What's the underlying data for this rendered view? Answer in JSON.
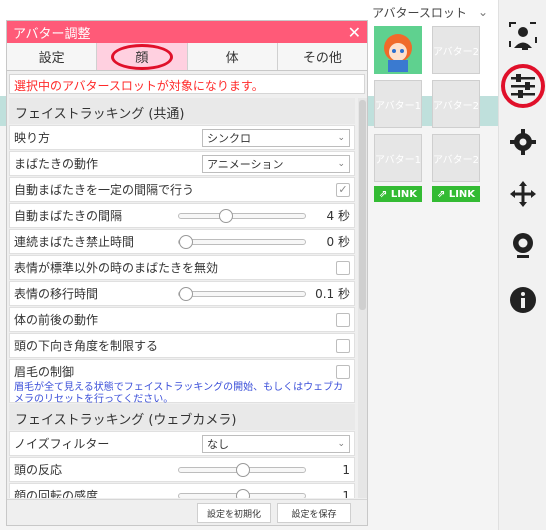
{
  "window": {
    "title": "アバター調整",
    "close_symbol": "✕"
  },
  "tabs": [
    {
      "label": "設定"
    },
    {
      "label": "顔",
      "active": true
    },
    {
      "label": "体"
    },
    {
      "label": "その他"
    }
  ],
  "notice": "選択中のアバタースロットが対象になります。",
  "sections": {
    "face_tracking_common": "フェイストラッキング (共通)",
    "face_tracking_webcam": "フェイストラッキング (ウェブカメラ)"
  },
  "rows": {
    "reflection": {
      "label": "映り方",
      "value": "シンクロ"
    },
    "blink_action": {
      "label": "まばたきの動作",
      "value": "アニメーション"
    },
    "blink_regular": {
      "label": "自動まばたきを一定の間隔で行う",
      "checked": true
    },
    "blink_interval": {
      "label": "自動まばたきの間隔",
      "value": "4 秒",
      "level": 0.35
    },
    "blink_cooldown": {
      "label": "連続まばたき禁止時間",
      "value": "0 秒",
      "level": 0.0
    },
    "disable_blink": {
      "label": "表情が標準以外の時のまばたきを無効",
      "checked": false
    },
    "expression_transition": {
      "label": "表情の移行時間",
      "value": "0.1 秒",
      "level": 0.0
    },
    "body_forward": {
      "label": "体の前後の動作",
      "checked": false
    },
    "head_down_limit": {
      "label": "頭の下向き角度を制限する",
      "checked": false
    },
    "eyebrow_control": {
      "label": "眉毛の制御",
      "checked": false,
      "note": "眉毛が全て見える状態でフェイストラッキングの開始、もしくはウェブカメラのリセットを行ってください。"
    },
    "noise_filter": {
      "label": "ノイズフィルター",
      "value": "なし"
    },
    "head_response": {
      "label": "頭の反応",
      "value": "1",
      "level": 0.5
    },
    "face_rotation": {
      "label": "顔の回転の感度",
      "value": "1",
      "level": 0.5
    }
  },
  "footer": {
    "reset_label": "設定を初期化",
    "save_label": "設定を保存"
  },
  "avatar_slots": {
    "title": "アバタースロット",
    "slot1_label": "アバター1",
    "slot2_label": "アバター2",
    "link_label": "LINK"
  },
  "toolbar": {
    "icons": [
      "person-icon",
      "sliders-icon",
      "gear-icon",
      "move-icon",
      "webcam-icon",
      "info-icon"
    ]
  },
  "colors": {
    "accent": "#ff5a78",
    "highlight": "#e0102a",
    "link": "#33bb33",
    "note": "#3b4fd9"
  }
}
